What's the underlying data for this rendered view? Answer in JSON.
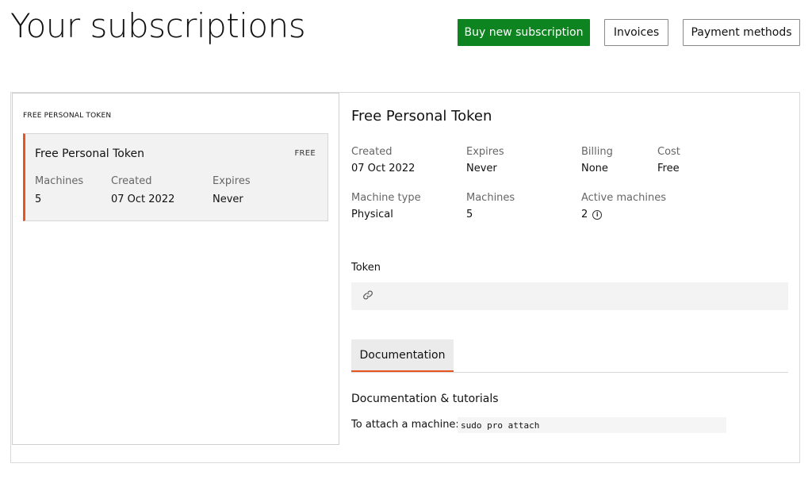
{
  "header": {
    "title": "Your subscriptions",
    "buy_label": "Buy new subscription",
    "invoices_label": "Invoices",
    "payment_label": "Payment methods"
  },
  "list": {
    "section_label": "FREE PERSONAL TOKEN",
    "card": {
      "name": "Free Personal Token",
      "tag": "FREE",
      "machines_label": "Machines",
      "machines_value": "5",
      "created_label": "Created",
      "created_value": "07 Oct 2022",
      "expires_label": "Expires",
      "expires_value": "Never"
    }
  },
  "detail": {
    "title": "Free Personal Token",
    "created_label": "Created",
    "created_value": "07 Oct 2022",
    "expires_label": "Expires",
    "expires_value": "Never",
    "billing_label": "Billing",
    "billing_value": "None",
    "cost_label": "Cost",
    "cost_value": "Free",
    "machine_type_label": "Machine type",
    "machine_type_value": "Physical",
    "machines_label": "Machines",
    "machines_value": "5",
    "active_label": "Active machines",
    "active_value": "2",
    "token_heading": "Token",
    "token_icon": "link-icon",
    "tab_label": "Documentation",
    "doc_heading": "Documentation & tutorials",
    "attach_label": "To attach a machine:",
    "attach_command": "sudo pro attach"
  },
  "colors": {
    "primary_button": "#0e8420",
    "accent": "#e95420"
  }
}
